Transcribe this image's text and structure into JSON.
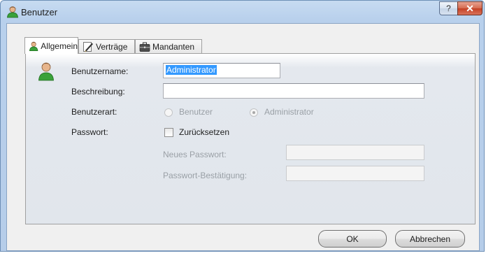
{
  "window": {
    "title": "Benutzer",
    "help_label": "?",
    "close_label": "✕"
  },
  "tabs": [
    {
      "label": "Allgemein",
      "icon": "user-icon",
      "active": true
    },
    {
      "label": "Verträge",
      "icon": "contract-pen-icon",
      "active": false
    },
    {
      "label": "Mandanten",
      "icon": "briefcase-icon",
      "active": false
    }
  ],
  "form": {
    "username_label": "Benutzername:",
    "username_value": "Administrator",
    "description_label": "Beschreibung:",
    "description_value": "",
    "usertype_label": "Benutzerart:",
    "usertype_options": [
      "Benutzer",
      "Administrator"
    ],
    "usertype_selected": "Administrator",
    "password_label": "Passwort:",
    "reset_label": "Zurücksetzen",
    "reset_checked": false,
    "new_password_label": "Neues Passwort:",
    "confirm_password_label": "Passwort-Bestätigung:"
  },
  "buttons": {
    "ok": "OK",
    "cancel": "Abbrechen"
  },
  "colors": {
    "selection": "#3399ff",
    "close_button": "#c44024",
    "frame": "#b8d0ec"
  }
}
